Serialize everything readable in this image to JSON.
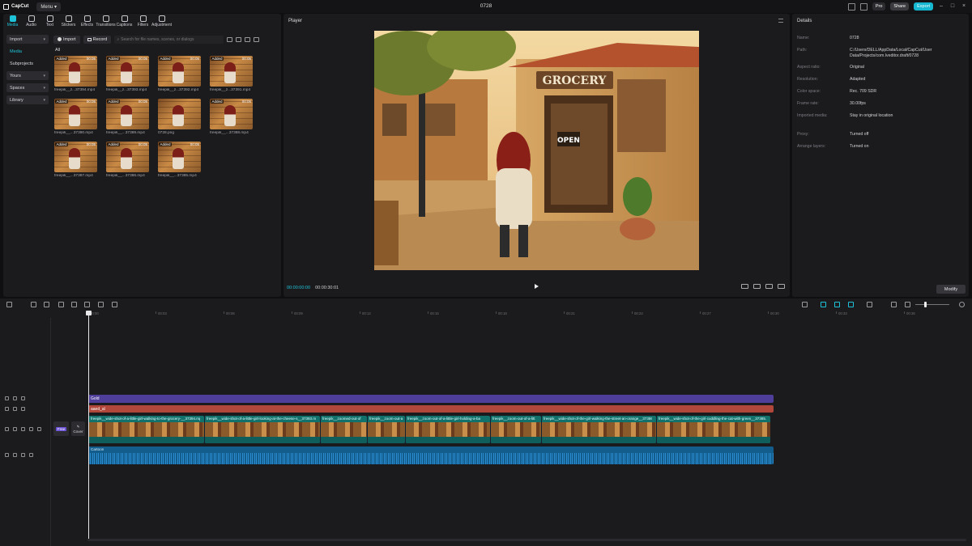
{
  "titlebar": {
    "app_name": "CapCut",
    "menu_label": "Menu",
    "project_title": "0728",
    "pro_label": "Pro",
    "share_label": "Share",
    "export_label": "Export"
  },
  "media_tabs": [
    {
      "label": "Media",
      "icon": "media-icon",
      "active": true
    },
    {
      "label": "Audio",
      "icon": "audio-icon"
    },
    {
      "label": "Text",
      "icon": "text-icon"
    },
    {
      "label": "Stickers",
      "icon": "stickers-icon"
    },
    {
      "label": "Effects",
      "icon": "effects-icon"
    },
    {
      "label": "Transitions",
      "icon": "transitions-icon"
    },
    {
      "label": "Captions",
      "icon": "captions-icon"
    },
    {
      "label": "Filters",
      "icon": "filters-icon"
    },
    {
      "label": "Adjustment",
      "icon": "adjustment-icon"
    }
  ],
  "sidebar": {
    "items": [
      {
        "label": "Import",
        "has_caret": true
      },
      {
        "label": "Media"
      },
      {
        "label": "Subprojects"
      },
      {
        "label": "Yours",
        "has_caret": true
      },
      {
        "label": "Spaces",
        "has_caret": true
      },
      {
        "label": "Library",
        "has_caret": true
      }
    ]
  },
  "media_toolbar": {
    "import_label": "Import",
    "record_label": "Record",
    "search_placeholder": "Search for file names, scenes, or dialogs"
  },
  "media_filter_label": "All",
  "media_items": [
    {
      "name": "freepik__z...37394.mp4",
      "badge": "Added",
      "duration": "00:05"
    },
    {
      "name": "freepik__z...37393.mp4",
      "badge": "Added",
      "duration": "00:05"
    },
    {
      "name": "freepik__z...37392.mp4",
      "badge": "Added",
      "duration": "00:05"
    },
    {
      "name": "freepik__z...37391.mp4",
      "badge": "Added",
      "duration": "00:05"
    },
    {
      "name": "freepik__...37390.mp4",
      "badge": "Added",
      "duration": "00:05"
    },
    {
      "name": "freepik__...37389.mp4",
      "badge": "Added",
      "duration": "00:05"
    },
    {
      "name": "0728.png",
      "badge": "",
      "duration": ""
    },
    {
      "name": "freepik__...37388.mp4",
      "badge": "Added",
      "duration": "00:05"
    },
    {
      "name": "freepik__...37387.mp4",
      "badge": "Added",
      "duration": "00:05"
    },
    {
      "name": "freepik__...37386.mp4",
      "badge": "Added",
      "duration": "00:05"
    },
    {
      "name": "freepik__...37385.mp4",
      "badge": "Added",
      "duration": "00:05"
    }
  ],
  "player": {
    "header": "Player",
    "current_time": "00:00:00:00",
    "total_time": "00:00:30:01",
    "sign_text": "GROCERY",
    "door_sign": "OPEN"
  },
  "details": {
    "header": "Details",
    "rows": [
      {
        "label": "Name:",
        "value": "0728"
      },
      {
        "label": "Path:",
        "value": "C:/Users/DELL/AppData/Local/CapCut/User Data/Projects/com.lveditor.draft/0728"
      },
      {
        "label": "Aspect ratio:",
        "value": "Original"
      },
      {
        "label": "Resolution:",
        "value": "Adapted"
      },
      {
        "label": "Color space:",
        "value": "Rec. 709 SDR"
      },
      {
        "label": "Frame rate:",
        "value": "30.00fps"
      },
      {
        "label": "Imported media:",
        "value": "Stay in original location"
      },
      {
        "label": "Proxy:",
        "value": "Turned off"
      },
      {
        "label": "Arrange layers:",
        "value": "Turned on"
      }
    ],
    "modify_label": "Modify"
  },
  "timeline": {
    "ruler_ticks": [
      "00:00",
      "00:03",
      "00:06",
      "00:09",
      "00:12",
      "00:15",
      "00:18",
      "00:21",
      "00:24",
      "00:27",
      "00:30",
      "00:33",
      "00:36"
    ],
    "effect_clip_label": "Gold",
    "text_clip_label": "aaed_al",
    "cover_label": "Cover",
    "free_label": "Free",
    "audio_label": "Cartoon",
    "video_clips": [
      {
        "label": "freepik__wide-shot-of-a-little-girl-walking-to-the-grocery-__37394.mp4"
      },
      {
        "label": "freepik__wide-shot-of-a-little-girl-looking-at-the-cheese-s__37393.mp4"
      },
      {
        "label": "freepik__zoomed-out-of"
      },
      {
        "label": "freepik__zoom-out-a"
      },
      {
        "label": "freepik__zoom-out-of-a-little-girl-holding-a-ba"
      },
      {
        "label": "freepik__zoom-out-of-a-litt"
      },
      {
        "label": "freepik__wide-shot-of-the-girl-walking-the-street-an-orange__37386.mp4"
      },
      {
        "label": "freepik__wide-shot-of-the-girl-cuddling-the-cat-with-green__37385.mp4"
      }
    ]
  },
  "colors": {
    "accent": "#1fc3d9",
    "effect_track": "#4f3f9a",
    "text_track": "#b0473a",
    "video_band": "#0f5e5c",
    "audio_track": "#125d8c"
  }
}
